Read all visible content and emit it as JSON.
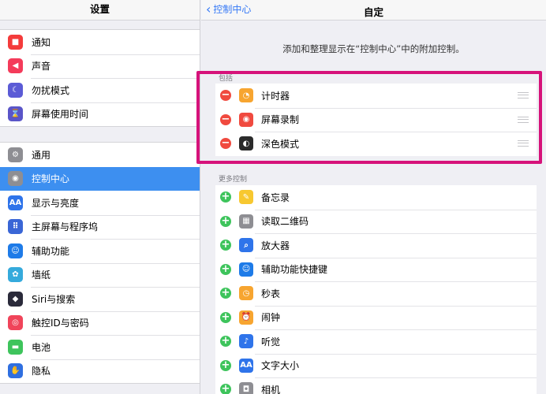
{
  "left": {
    "title": "设置",
    "group1": [
      {
        "label": "通知",
        "icon": "notifications-icon",
        "color": "#f43b3b",
        "glyph": "■"
      },
      {
        "label": "声音",
        "icon": "sound-icon",
        "color": "#f43b5a",
        "glyph": "◀"
      },
      {
        "label": "勿扰模式",
        "icon": "moon-icon",
        "color": "#5b5bd6",
        "glyph": "☾"
      },
      {
        "label": "屏幕使用时间",
        "icon": "hourglass-icon",
        "color": "#5a55c8",
        "glyph": "⌛"
      }
    ],
    "group2": [
      {
        "label": "通用",
        "icon": "gear-icon",
        "color": "#8e8e93",
        "glyph": "⚙"
      },
      {
        "label": "控制中心",
        "icon": "control-center-icon",
        "color": "#8e8e93",
        "glyph": "◉",
        "selected": true
      },
      {
        "label": "显示与亮度",
        "icon": "display-icon",
        "color": "#2f74ea",
        "glyph": "AA"
      },
      {
        "label": "主屏幕与程序坞",
        "icon": "home-screen-icon",
        "color": "#3a66d6",
        "glyph": "⠿"
      },
      {
        "label": "辅助功能",
        "icon": "accessibility-icon",
        "color": "#1e7be8",
        "glyph": "☺"
      },
      {
        "label": "墙纸",
        "icon": "wallpaper-icon",
        "color": "#35aadc",
        "glyph": "✿"
      },
      {
        "label": "Siri与搜索",
        "icon": "siri-icon",
        "color": "#2a2a3a",
        "glyph": "◆"
      },
      {
        "label": "触控ID与密码",
        "icon": "fingerprint-icon",
        "color": "#f0445a",
        "glyph": "◎"
      },
      {
        "label": "电池",
        "icon": "battery-icon",
        "color": "#3ec45c",
        "glyph": "▬"
      },
      {
        "label": "隐私",
        "icon": "hand-icon",
        "color": "#2f6fe0",
        "glyph": "✋"
      }
    ]
  },
  "right": {
    "back_label": "控制中心",
    "title": "自定",
    "description": "添加和整理显示在“控制中心”中的附加控制。",
    "include_label": "包括",
    "included": [
      {
        "label": "计时器",
        "icon": "timer-icon",
        "color": "#f7a530",
        "glyph": "◔"
      },
      {
        "label": "屏幕录制",
        "icon": "screen-record-icon",
        "color": "#f04a3f",
        "glyph": "◉"
      },
      {
        "label": "深色模式",
        "icon": "dark-mode-icon",
        "color": "#2b2b2b",
        "glyph": "◐"
      }
    ],
    "more_label": "更多控制",
    "more": [
      {
        "label": "备忘录",
        "icon": "notes-icon",
        "color": "#f7c830",
        "glyph": "✎"
      },
      {
        "label": "读取二维码",
        "icon": "qr-code-icon",
        "color": "#8e8e93",
        "glyph": "▦"
      },
      {
        "label": "放大器",
        "icon": "magnifier-icon",
        "color": "#2f74ea",
        "glyph": "⌕"
      },
      {
        "label": "辅助功能快捷键",
        "icon": "accessibility-shortcut-icon",
        "color": "#1e7be8",
        "glyph": "☺"
      },
      {
        "label": "秒表",
        "icon": "stopwatch-icon",
        "color": "#f7a530",
        "glyph": "◷"
      },
      {
        "label": "闹钟",
        "icon": "alarm-icon",
        "color": "#f7a530",
        "glyph": "⏰"
      },
      {
        "label": "听觉",
        "icon": "hearing-icon",
        "color": "#2f74ea",
        "glyph": "♪"
      },
      {
        "label": "文字大小",
        "icon": "text-size-icon",
        "color": "#2f74ea",
        "glyph": "AA"
      },
      {
        "label": "相机",
        "icon": "camera-icon",
        "color": "#8e8e93",
        "glyph": "◘"
      }
    ]
  },
  "highlight_color": "#d6127a"
}
